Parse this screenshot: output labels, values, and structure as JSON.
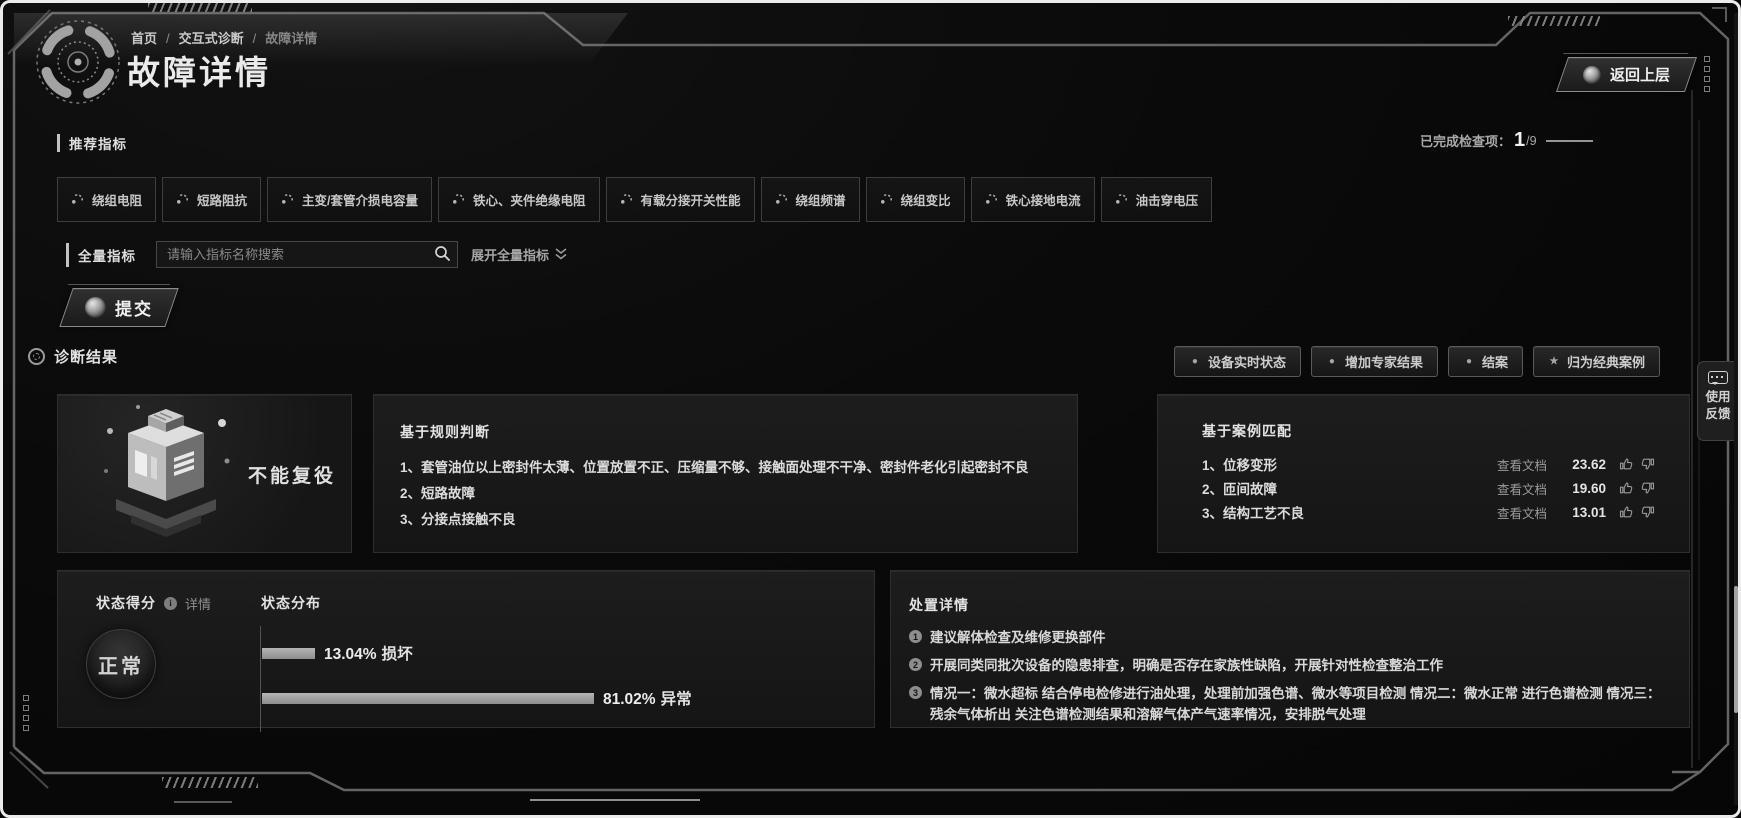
{
  "breadcrumb": {
    "items": [
      "首页",
      "交互式诊断",
      "故障详情"
    ]
  },
  "header": {
    "title": "故障详情",
    "back_label": "返回上层"
  },
  "recommended": {
    "section_label": "推荐指标",
    "completed": {
      "label": "已完成检查项：",
      "count": "1",
      "total": "/9"
    },
    "indicators": [
      "绕组电阻",
      "短路阻抗",
      "主变/套管介损电容量",
      "铁心、夹件绝缘电阻",
      "有载分接开关性能",
      "绕组频谱",
      "绕组变比",
      "铁心接地电流",
      "油击穿电压"
    ]
  },
  "full_indicators": {
    "section_label": "全量指标",
    "search_placeholder": "请输入指标名称搜索",
    "expand_label": "展开全量指标"
  },
  "submit": {
    "label": "提交"
  },
  "diagnosis": {
    "section_label": "诊断结果",
    "actions": [
      {
        "label": "设备实时状态",
        "icon_glyph": "●"
      },
      {
        "label": "增加专家结果",
        "icon_glyph": "●"
      },
      {
        "label": "结案",
        "icon_glyph": "●"
      },
      {
        "label": "归为经典案例",
        "icon_glyph": "★"
      }
    ],
    "verdict": "不能复役",
    "rule_card": {
      "title": "基于规则判断",
      "items": [
        "1、套管油位以上密封件太薄、位置放置不正、压缩量不够、接触面处理不干净、密封件老化引起密封不良",
        "2、短路故障",
        "3、分接点接触不良"
      ]
    },
    "case_card": {
      "title": "基于案例匹配",
      "items": [
        {
          "name": "1、位移变形",
          "doc": "查看文档",
          "score": "23.62"
        },
        {
          "name": "2、匝间故障",
          "doc": "查看文档",
          "score": "19.60"
        },
        {
          "name": "3、结构工艺不良",
          "doc": "查看文档",
          "score": "13.01"
        }
      ]
    }
  },
  "status_card": {
    "score_label": "状态得分",
    "detail_label": "详情",
    "score_value": "正常",
    "dist_label": "状态分布",
    "bars": [
      {
        "value": 13.04,
        "pct": "13.04%",
        "label": "损坏"
      },
      {
        "value": 81.02,
        "pct": "81.02%",
        "label": "异常"
      }
    ]
  },
  "disposal_card": {
    "title": "处置详情",
    "items": [
      {
        "num": "1",
        "text": "建议解体检查及维修更换部件"
      },
      {
        "num": "2",
        "text": "开展同类同批次设备的隐患排查，明确是否存在家族性缺陷，开展针对性检查整治工作"
      },
      {
        "num": "3",
        "text": "情况一：微水超标 结合停电检修进行油处理，处理前加强色谱、微水等项目检测 情况二：微水正常 进行色谱检测 情况三：残余气体析出 关注色谱检测结果和溶解气体产气速率情况，安排脱气处理"
      }
    ]
  },
  "feedback_tab": {
    "label": "使用反馈"
  },
  "colors": {
    "page_bg": "#0a0a0a",
    "card_bg": "#1a1a1a",
    "text_primary": "#d6d6d6",
    "text_dim": "#8f8f8f",
    "bar_fill": "#a6a6a6",
    "frame_line": "#707070"
  }
}
